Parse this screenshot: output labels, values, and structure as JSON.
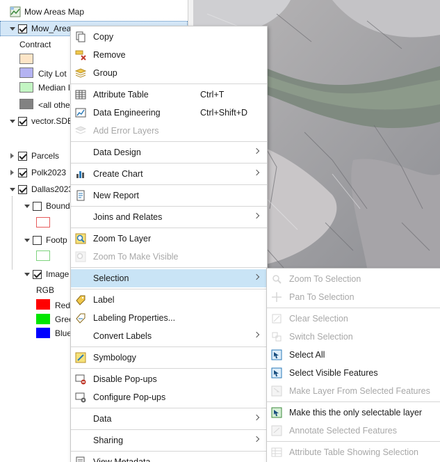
{
  "contents": {
    "map_name": "Mow Areas Map",
    "layers": {
      "mow_areas": "Mow_Area",
      "contract_heading": "Contract",
      "legend": [
        "",
        "City Lot",
        "Median I",
        "<all othe"
      ],
      "legend_colors": [
        "#fde5c7",
        "#b4b3f2",
        "#c3f5c3",
        "#828282"
      ],
      "vector": "vector.SDE",
      "parcels": "Parcels",
      "polk": "Polk2023",
      "dallas": "Dallas2023",
      "bound": "Bound",
      "footp": "Footp",
      "image": "Image",
      "rgb_heading": "RGB",
      "rgb_bands": [
        "Red",
        "Gree",
        "Blue"
      ],
      "rgb_colors": [
        "#ff0000",
        "#00e600",
        "#0000ff"
      ]
    }
  },
  "context_menu": {
    "items": [
      {
        "label": "Copy",
        "icon": "copy-icon"
      },
      {
        "label": "Remove",
        "icon": "remove-icon"
      },
      {
        "label": "Group",
        "icon": "group-icon"
      },
      {
        "label": "Attribute Table",
        "shortcut": "Ctrl+T",
        "icon": "table-icon"
      },
      {
        "label": "Data Engineering",
        "shortcut": "Ctrl+Shift+D",
        "icon": "data-engineering-icon"
      },
      {
        "label": "Add Error Layers",
        "icon": "error-layers-icon",
        "disabled": true
      },
      {
        "label": "Data Design",
        "submenu": true
      },
      {
        "label": "Create Chart",
        "submenu": true,
        "icon": "chart-icon"
      },
      {
        "label": "New Report",
        "icon": "report-icon"
      },
      {
        "label": "Joins and Relates",
        "submenu": true
      },
      {
        "label": "Zoom To Layer",
        "icon": "zoom-layer-icon"
      },
      {
        "label": "Zoom To Make Visible",
        "icon": "zoom-visible-icon",
        "disabled": true
      },
      {
        "label": "Selection",
        "submenu": true,
        "highlighted": true
      },
      {
        "label": "Label",
        "icon": "label-icon"
      },
      {
        "label": "Labeling Properties...",
        "icon": "labeling-properties-icon"
      },
      {
        "label": "Convert Labels",
        "submenu": true
      },
      {
        "label": "Symbology",
        "icon": "symbology-icon"
      },
      {
        "label": "Disable Pop-ups",
        "icon": "disable-popups-icon"
      },
      {
        "label": "Configure Pop-ups",
        "icon": "configure-popups-icon"
      },
      {
        "label": "Data",
        "submenu": true
      },
      {
        "label": "Sharing",
        "submenu": true
      },
      {
        "label": "View Metadata",
        "icon": "metadata-icon"
      }
    ]
  },
  "selection_submenu": {
    "items": [
      {
        "label": "Zoom To Selection",
        "disabled": true,
        "icon": "zoom-selection-icon"
      },
      {
        "label": "Pan To Selection",
        "disabled": true,
        "icon": "pan-selection-icon"
      },
      {
        "label": "Clear Selection",
        "disabled": true,
        "icon": "clear-selection-icon"
      },
      {
        "label": "Switch Selection",
        "disabled": true,
        "icon": "switch-selection-icon"
      },
      {
        "label": "Select All",
        "icon": "select-all-icon"
      },
      {
        "label": "Select Visible Features",
        "icon": "select-visible-icon"
      },
      {
        "label": "Make Layer From Selected Features",
        "disabled": true,
        "icon": "make-layer-icon"
      },
      {
        "label": "Make this the only selectable layer",
        "icon": "only-selectable-icon"
      },
      {
        "label": "Annotate Selected Features",
        "disabled": true,
        "icon": "annotate-icon"
      },
      {
        "label": "Attribute Table Showing Selection",
        "disabled": true,
        "icon": "table-selection-icon"
      }
    ]
  },
  "colors": {
    "highlight": "#c9e4f6",
    "disabled_text": "#a8a8a8"
  }
}
